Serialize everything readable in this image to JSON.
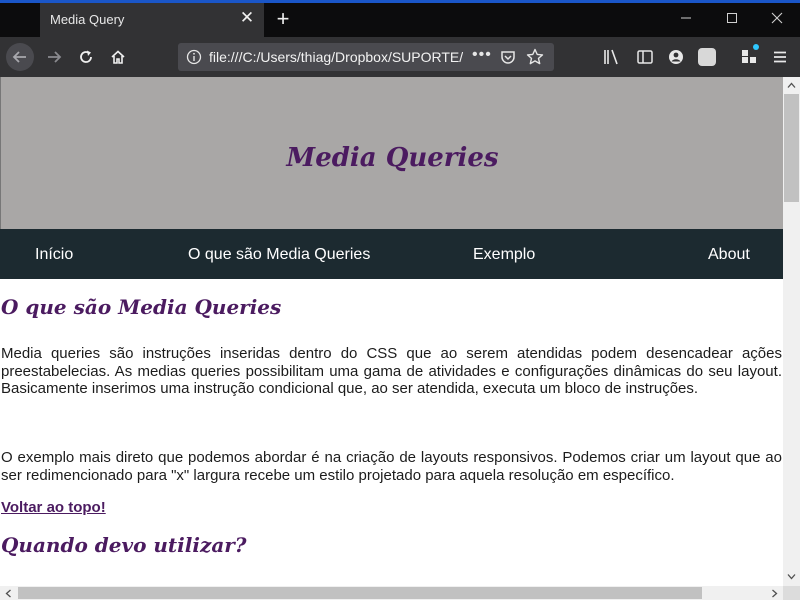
{
  "browser": {
    "tab_title": "Media Query",
    "url": "file:///C:/Users/thiag/Dropbox/SUPORTE/media-queries/index.html",
    "accent": "#1a56c8"
  },
  "page": {
    "hero_title": "Media Queries",
    "nav": [
      "Início",
      "O que são Media Queries",
      "Exemplo",
      "About"
    ],
    "section1": {
      "heading": "O que são Media Queries",
      "p1": "Media queries são instruções inseridas dentro do CSS que ao serem atendidas podem desencadear ações preestabelecias. As medias queries possibilitam uma gama de atividades e configurações dinâmicas do seu layout. Basicamente inserimos uma instrução condicional que, ao ser atendida, executa um bloco de instruções.",
      "p2": "O exemplo mais direto que podemos abordar é na criação de layouts responsivos. Podemos criar um layout que ao ser redimencionado para \"x\" largura recebe um estilo projetado para aquela resolução em específico.",
      "back_to_top": "Voltar ao topo!"
    },
    "section2": {
      "heading": "Quando devo utilizar?"
    },
    "colors": {
      "brand_purple": "#4b1b60",
      "hero_bg": "#a9a7a6",
      "nav_bg": "#1c2a30"
    }
  }
}
